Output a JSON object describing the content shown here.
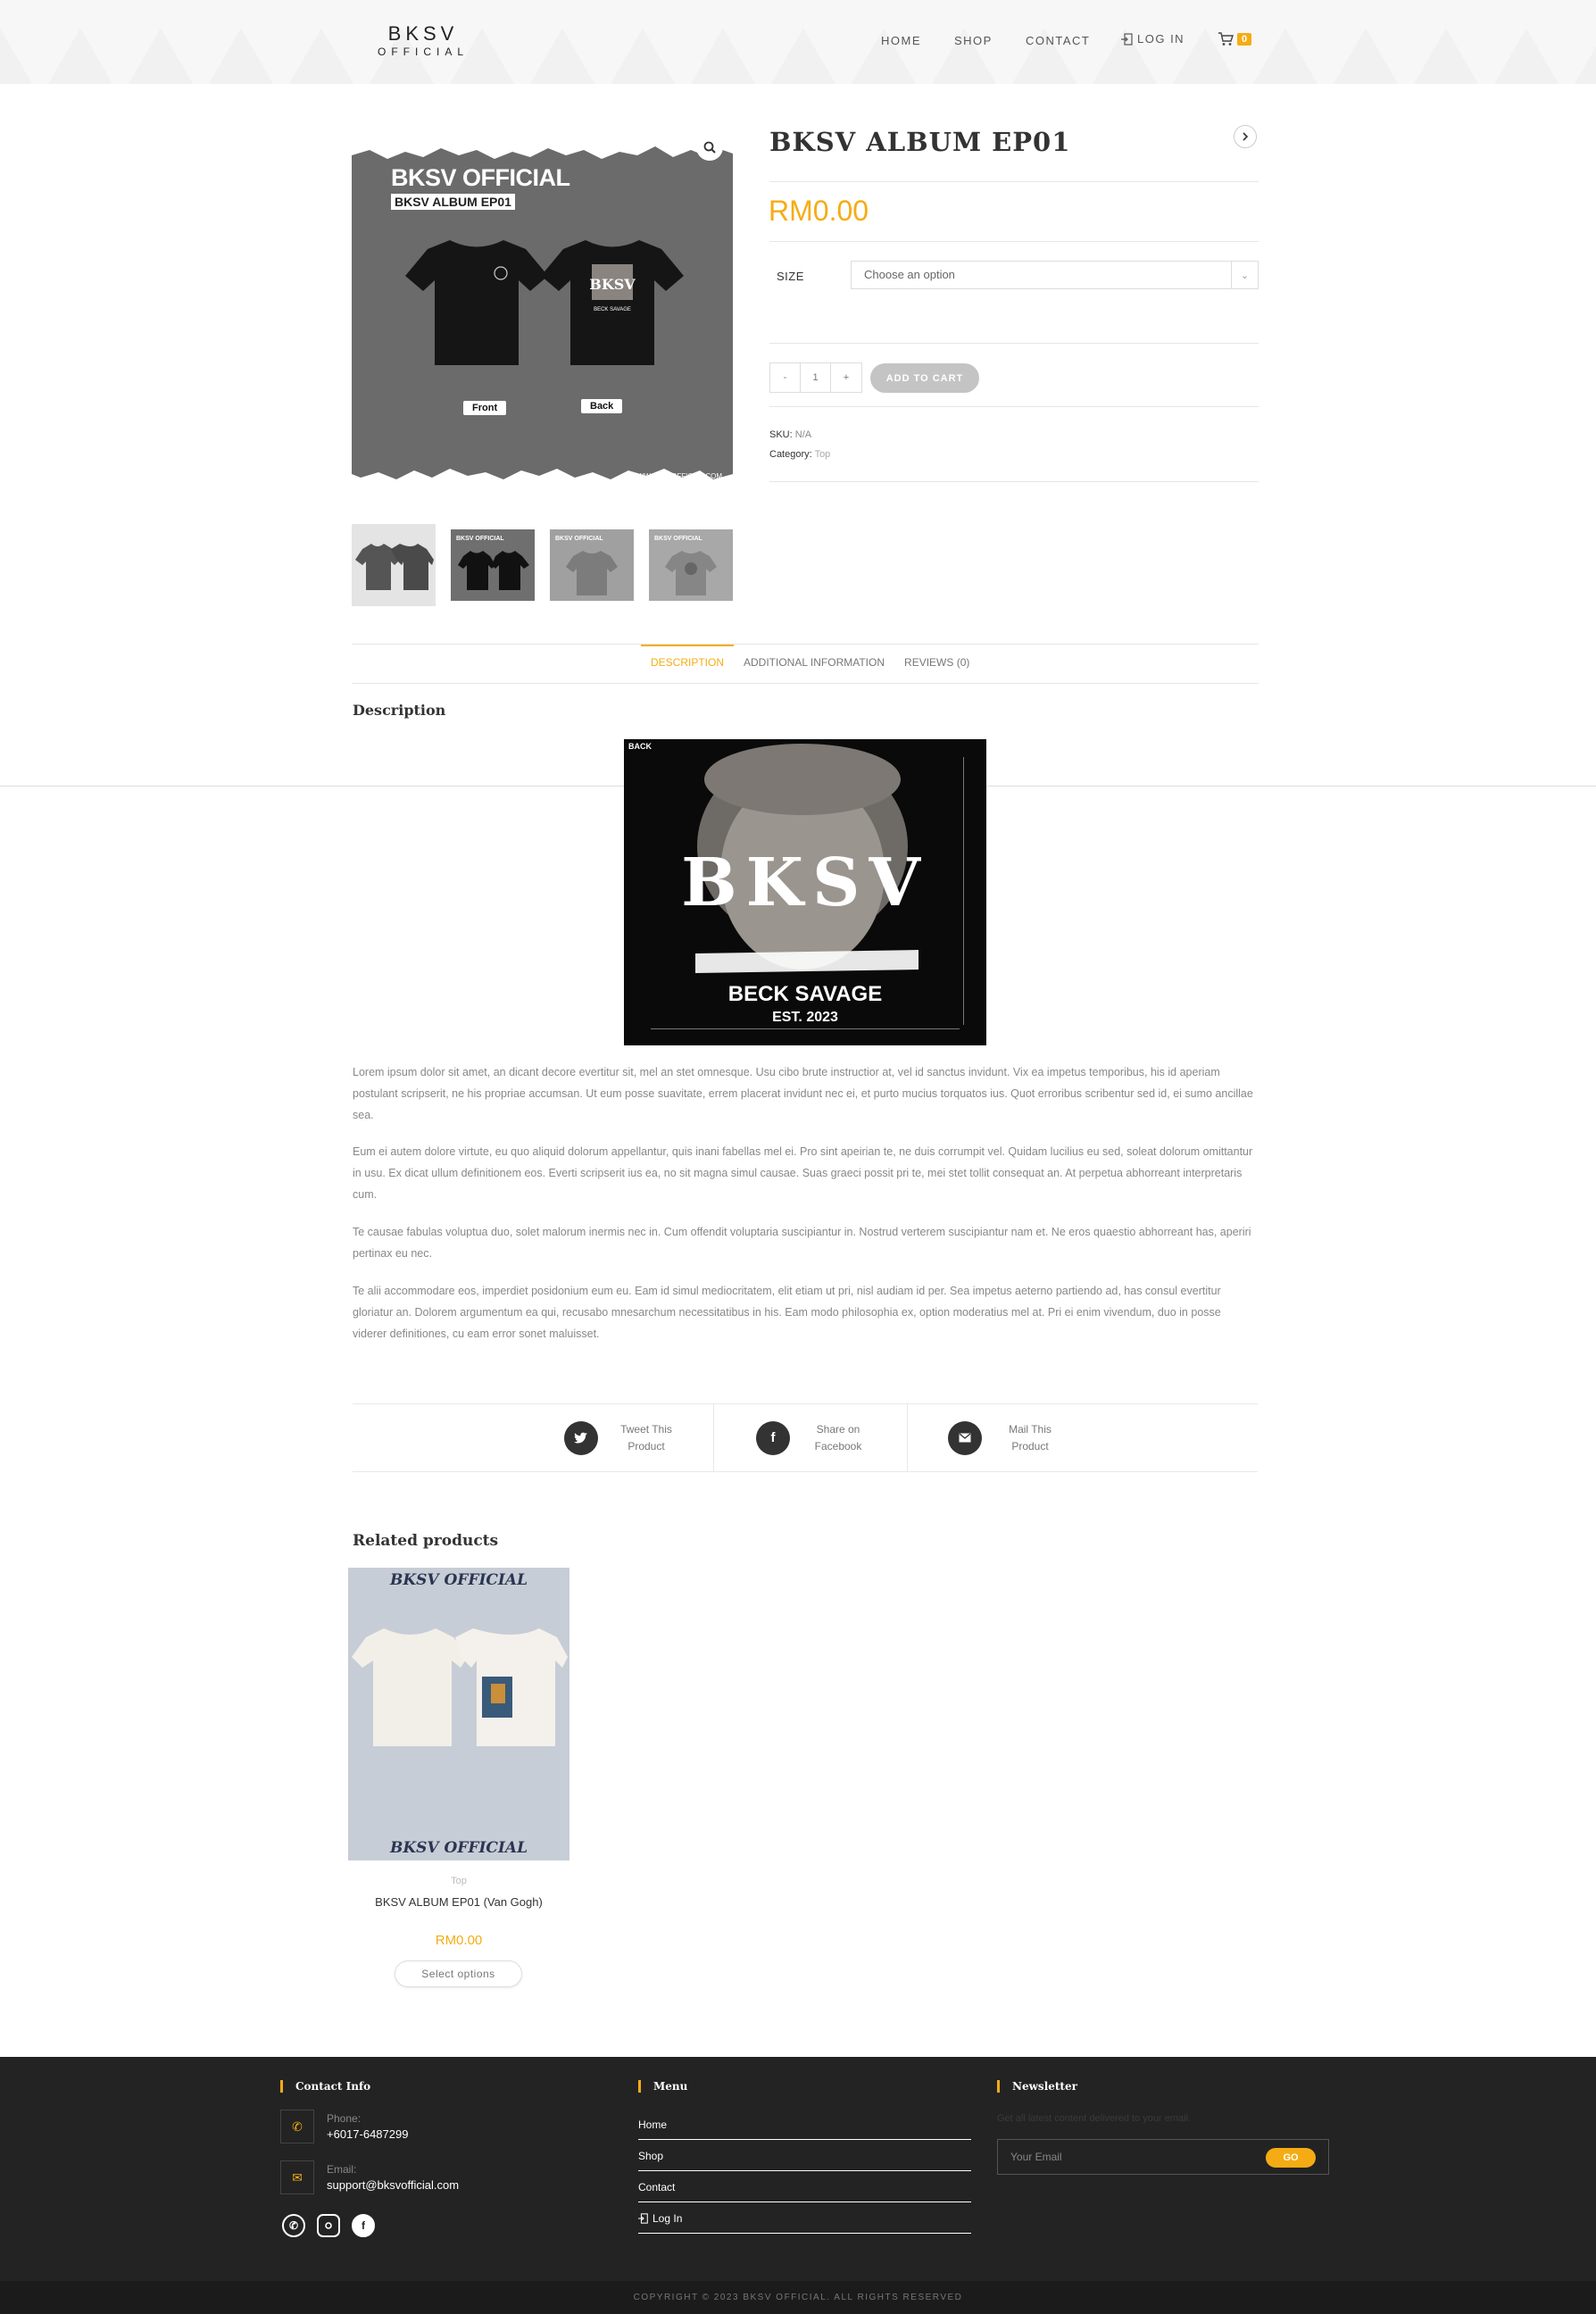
{
  "header": {
    "logo_top": "BKSV",
    "logo_bottom": "OFFICIAL",
    "nav": {
      "home": "HOME",
      "shop": "SHOP",
      "contact": "CONTACT",
      "login": "LOG IN"
    },
    "cart_count": "0"
  },
  "gallery": {
    "image_title": "BKSV OFFICIAL",
    "image_subtitle": "BKSV ALBUM EP01",
    "front_label": "Front",
    "back_label": "Back",
    "image_url": "WWW.BKSVOFFICIAL.COM",
    "zoom_icon": "magnifier-icon"
  },
  "product": {
    "title": "BKSV ALBUM EP01",
    "price": "RM0.00",
    "size_label": "SIZE",
    "size_placeholder": "Choose an option",
    "qty_minus": "-",
    "qty_value": "1",
    "qty_plus": "+",
    "add_to_cart": "ADD TO CART",
    "sku_label": "SKU:",
    "sku_value": "N/A",
    "category_label": "Category:",
    "category_value": "Top"
  },
  "tabs": {
    "description": "DESCRIPTION",
    "additional": "ADDITIONAL INFORMATION",
    "reviews": "REVIEWS (0)"
  },
  "description": {
    "heading": "Description",
    "image": {
      "back_label": "BACK",
      "big_text": "BKSV",
      "name": "BECK SAVAGE",
      "est": "EST. 2023"
    },
    "paragraphs": [
      "Lorem ipsum dolor sit amet, an dicant decore evertitur sit, mel an stet omnesque. Usu cibo brute instructior at, vel id sanctus invidunt. Vix ea impetus temporibus, his id aperiam postulant scripserit, ne his propriae accumsan. Ut eum posse suavitate, errem placerat invidunt nec ei, et purto mucius torquatos ius. Quot erroribus scribentur sed id, ei sumo ancillae sea.",
      "Eum ei autem dolore virtute, eu quo aliquid dolorum appellantur, quis inani fabellas mel ei. Pro sint apeirian te, ne duis corrumpit vel. Quidam lucilius eu sed, soleat dolorum omittantur in usu. Ex dicat ullum definitionem eos. Everti scripserit ius ea, no sit magna simul causae. Suas graeci possit pri te, mei stet tollit consequat an. At perpetua abhorreant interpretaris cum.",
      "Te causae fabulas voluptua duo, solet malorum inermis nec in. Cum offendit voluptaria suscipiantur in. Nostrud verterem suscipiantur nam et. Ne eros quaestio abhorreant has, aperiri pertinax eu nec.",
      "Te alii accommodare eos, imperdiet posidonium eum eu. Eam id simul mediocritatem, elit etiam ut pri, nisl audiam id per. Sea impetus aeterno partiendo ad, has consul evertitur gloriatur an. Dolorem argumentum ea qui, recusabo mnesarchum necessitatibus in his. Eam modo philosophia ex, option moderatius mel at. Pri ei enim vivendum, duo in posse viderer definitiones, cu eam error sonet maluisset."
    ]
  },
  "share": {
    "twitter": [
      "Tweet This",
      "Product"
    ],
    "facebook": [
      "Share on",
      "Facebook"
    ],
    "mail": [
      "Mail This",
      "Product"
    ]
  },
  "related": {
    "heading": "Related products",
    "item": {
      "image_text": "BKSV OFFICIAL",
      "category": "Top",
      "name": "BKSV ALBUM EP01 (Van Gogh)",
      "price": "RM0.00",
      "button": "Select options"
    }
  },
  "footer": {
    "contact": {
      "title": "Contact Info",
      "phone_label": "Phone:",
      "phone": "+6017-6487299",
      "email_label": "Email:",
      "email": "support@bksvofficial.com"
    },
    "menu": {
      "title": "Menu",
      "items": [
        "Home",
        "Shop",
        "Contact",
        "Log In"
      ]
    },
    "newsletter": {
      "title": "Newsletter",
      "hint": "Get all latest content delivered to your email.",
      "placeholder": "Your Email",
      "button": "GO"
    },
    "copyright": "COPYRIGHT © 2023 BKSV OFFICIAL. ALL RIGHTS RESERVED"
  },
  "colors": {
    "accent": "#f5ac14",
    "footer_bg": "#232323",
    "text_dark": "#333333"
  }
}
